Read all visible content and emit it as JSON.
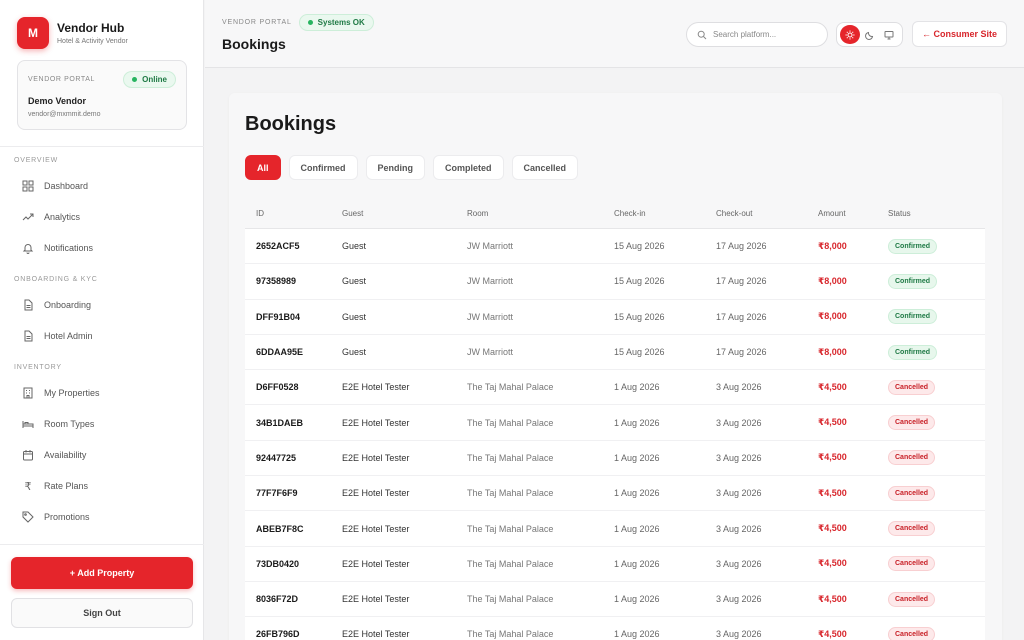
{
  "brand": {
    "logo_letter": "M",
    "title": "Vendor Hub",
    "subtitle": "Hotel & Activity Vendor"
  },
  "vendor_card": {
    "label": "VENDOR PORTAL",
    "status": "Online",
    "name": "Demo Vendor",
    "email": "vendor@mxmmit.demo"
  },
  "sidebar": {
    "sections": [
      {
        "title": "OVERVIEW",
        "items": [
          {
            "label": "Dashboard",
            "icon": "grid-icon"
          },
          {
            "label": "Analytics",
            "icon": "trending-up-icon"
          },
          {
            "label": "Notifications",
            "icon": "bell-icon"
          }
        ]
      },
      {
        "title": "ONBOARDING & KYC",
        "items": [
          {
            "label": "Onboarding",
            "icon": "document-icon"
          },
          {
            "label": "Hotel Admin",
            "icon": "document-icon"
          }
        ]
      },
      {
        "title": "INVENTORY",
        "items": [
          {
            "label": "My Properties",
            "icon": "building-icon"
          },
          {
            "label": "Room Types",
            "icon": "bed-icon"
          },
          {
            "label": "Availability",
            "icon": "calendar-icon"
          },
          {
            "label": "Rate Plans",
            "icon": "rupee-icon"
          },
          {
            "label": "Promotions",
            "icon": "tag-icon"
          }
        ]
      }
    ],
    "add_property": "+ Add Property",
    "sign_out": "Sign Out"
  },
  "header": {
    "eyebrow": "VENDOR PORTAL",
    "system_status": "Systems OK",
    "title": "Bookings",
    "search_placeholder": "Search platform...",
    "consumer_site": "← Consumer Site"
  },
  "main": {
    "title": "Bookings",
    "tabs": [
      {
        "label": "All",
        "active": true
      },
      {
        "label": "Confirmed",
        "active": false
      },
      {
        "label": "Pending",
        "active": false
      },
      {
        "label": "Completed",
        "active": false
      },
      {
        "label": "Cancelled",
        "active": false
      }
    ],
    "columns": [
      "ID",
      "Guest",
      "Room",
      "Check-in",
      "Check-out",
      "Amount",
      "Status"
    ],
    "rows": [
      {
        "id": "2652ACF5",
        "guest": "Guest",
        "room": "JW Marriott",
        "check_in": "15 Aug 2026",
        "check_out": "17 Aug 2026",
        "amount": "₹8,000",
        "status": "Confirmed"
      },
      {
        "id": "97358989",
        "guest": "Guest",
        "room": "JW Marriott",
        "check_in": "15 Aug 2026",
        "check_out": "17 Aug 2026",
        "amount": "₹8,000",
        "status": "Confirmed"
      },
      {
        "id": "DFF91B04",
        "guest": "Guest",
        "room": "JW Marriott",
        "check_in": "15 Aug 2026",
        "check_out": "17 Aug 2026",
        "amount": "₹8,000",
        "status": "Confirmed"
      },
      {
        "id": "6DDAA95E",
        "guest": "Guest",
        "room": "JW Marriott",
        "check_in": "15 Aug 2026",
        "check_out": "17 Aug 2026",
        "amount": "₹8,000",
        "status": "Confirmed"
      },
      {
        "id": "D6FF0528",
        "guest": "E2E Hotel Tester",
        "room": "The Taj Mahal Palace",
        "check_in": "1 Aug 2026",
        "check_out": "3 Aug 2026",
        "amount": "₹4,500",
        "status": "Cancelled"
      },
      {
        "id": "34B1DAEB",
        "guest": "E2E Hotel Tester",
        "room": "The Taj Mahal Palace",
        "check_in": "1 Aug 2026",
        "check_out": "3 Aug 2026",
        "amount": "₹4,500",
        "status": "Cancelled"
      },
      {
        "id": "92447725",
        "guest": "E2E Hotel Tester",
        "room": "The Taj Mahal Palace",
        "check_in": "1 Aug 2026",
        "check_out": "3 Aug 2026",
        "amount": "₹4,500",
        "status": "Cancelled"
      },
      {
        "id": "77F7F6F9",
        "guest": "E2E Hotel Tester",
        "room": "The Taj Mahal Palace",
        "check_in": "1 Aug 2026",
        "check_out": "3 Aug 2026",
        "amount": "₹4,500",
        "status": "Cancelled"
      },
      {
        "id": "ABEB7F8C",
        "guest": "E2E Hotel Tester",
        "room": "The Taj Mahal Palace",
        "check_in": "1 Aug 2026",
        "check_out": "3 Aug 2026",
        "amount": "₹4,500",
        "status": "Cancelled"
      },
      {
        "id": "73DB0420",
        "guest": "E2E Hotel Tester",
        "room": "The Taj Mahal Palace",
        "check_in": "1 Aug 2026",
        "check_out": "3 Aug 2026",
        "amount": "₹4,500",
        "status": "Cancelled"
      },
      {
        "id": "8036F72D",
        "guest": "E2E Hotel Tester",
        "room": "The Taj Mahal Palace",
        "check_in": "1 Aug 2026",
        "check_out": "3 Aug 2026",
        "amount": "₹4,500",
        "status": "Cancelled"
      },
      {
        "id": "26FB796D",
        "guest": "E2E Hotel Tester",
        "room": "The Taj Mahal Palace",
        "check_in": "1 Aug 2026",
        "check_out": "3 Aug 2026",
        "amount": "₹4,500",
        "status": "Cancelled"
      }
    ]
  },
  "colors": {
    "accent": "#e5252b",
    "success": "#27b460",
    "danger_text": "#c82027"
  }
}
